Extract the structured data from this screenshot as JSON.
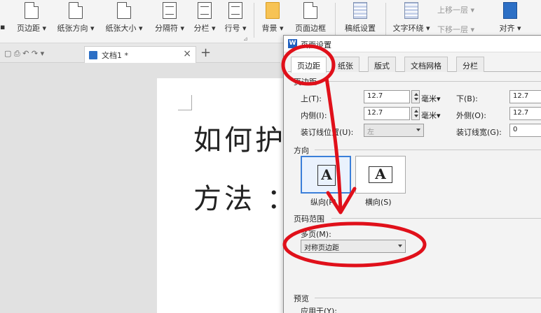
{
  "ribbon": {
    "buttons": [
      {
        "label": "页边距 ▾",
        "icon": "document-icon"
      },
      {
        "label": "纸张方向 ▾",
        "icon": "document-icon"
      },
      {
        "label": "纸张大小 ▾",
        "icon": "document-icon"
      },
      {
        "label": "分隔符 ▾",
        "icon": "section-break-icon"
      },
      {
        "label": "分栏 ▾",
        "icon": "columns-icon"
      },
      {
        "label": "行号 ▾",
        "icon": "line-number-icon"
      },
      {
        "label": "背景 ▾",
        "icon": "background-icon"
      },
      {
        "label": "页面边框",
        "icon": "page-border-icon"
      },
      {
        "label": "稿纸设置",
        "icon": "manuscript-icon"
      },
      {
        "label": "文字环绕 ▾",
        "icon": "text-wrap-icon"
      },
      {
        "label": "对齐 ▾",
        "icon": "align-icon"
      }
    ],
    "left_cut": "▪",
    "up_layer": "上移一层 ▾",
    "down_layer": "下移一层 ▾",
    "group_tag": "⊿"
  },
  "tabbar": {
    "doc_name": "文档1 *",
    "close": "×",
    "new_tab": "+"
  },
  "document": {
    "line1": "如何护",
    "line2": "方法 ："
  },
  "dialog": {
    "title": "页面设置",
    "app_icon": "W",
    "tabs": [
      "页边距",
      "纸张",
      "版式",
      "文档网格",
      "分栏"
    ],
    "margins_section": "页边距",
    "top_label": "上(T):",
    "top_value": "12.7",
    "bottom_label": "下(B):",
    "bottom_value": "12.7",
    "inside_label": "内侧(I):",
    "inside_value": "12.7",
    "outside_label": "外侧(O):",
    "outside_value": "12.7",
    "unit": "毫米▾",
    "gutter_pos_label": "装订线位置(U):",
    "gutter_pos_value": "左",
    "gutter_width_label": "装订线宽(G):",
    "gutter_width_value": "0",
    "orientation_section": "方向",
    "portrait_label": "纵向(P)",
    "landscape_label": "横向(S)",
    "orient_glyph": "A",
    "page_range_section": "页码范围",
    "multi_page_label": "多页(M):",
    "multi_page_value": "对称页边距",
    "preview_section": "预览",
    "apply_to_label": "应用于(Y):"
  },
  "colors": {
    "annotation_red": "#e0101a",
    "selection_blue": "#3b7fd9"
  }
}
